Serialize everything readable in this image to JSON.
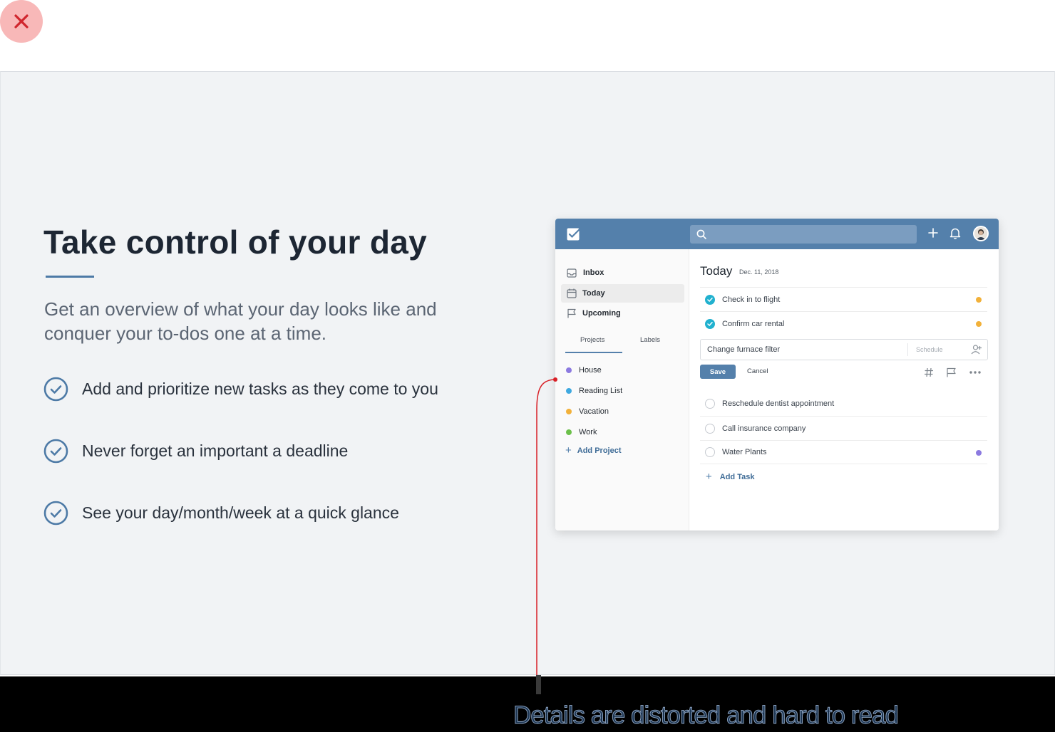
{
  "slide": {
    "headline": "Take control of your day",
    "subhead": "Get an overview of what your day looks like and conquer your to-dos one at a time.",
    "features": [
      {
        "label": "Add and prioritize new tasks as they come to you",
        "icon": "check-circle-icon"
      },
      {
        "label": "Never forget an important a deadline",
        "icon": "check-circle-icon"
      },
      {
        "label": "See your day/month/week at a quick glance",
        "icon": "check-circle-icon"
      }
    ]
  },
  "app": {
    "colors": {
      "header": "#5480ab",
      "done": "#21b1cf"
    },
    "nav": [
      {
        "label": "Inbox",
        "icon": "inbox-icon"
      },
      {
        "label": "Today",
        "icon": "calendar-icon"
      },
      {
        "label": "Upcoming",
        "icon": "flag-icon"
      }
    ],
    "tabs": {
      "projects": "Projects",
      "labels": "Labels"
    },
    "projects": [
      {
        "label": "House",
        "color": "#8c7ae0"
      },
      {
        "label": "Reading List",
        "color": "#3fa9e0"
      },
      {
        "label": "Vacation",
        "color": "#f2b13a"
      },
      {
        "label": "Work",
        "color": "#6cc04a"
      }
    ],
    "add_project": "Add Project",
    "main": {
      "title": "Today",
      "date": "Dec. 11, 2018",
      "done_tasks": [
        {
          "label": "Check in to flight",
          "flag": "#f2b13a"
        },
        {
          "label": "Confirm car rental",
          "flag": "#f2b13a"
        }
      ],
      "edit": {
        "value": "Change furnace filter",
        "schedule_placeholder": "Schedule",
        "save": "Save",
        "cancel": "Cancel"
      },
      "open_tasks": [
        {
          "label": "Reschedule dentist appointment"
        },
        {
          "label": "Call insurance company"
        },
        {
          "label": "Water Plants",
          "flag": "#8c7ae0"
        }
      ],
      "add_task": "Add Task"
    }
  },
  "annotation": {
    "caption": "Details are distorted and hard to read",
    "color": "#d81f26"
  }
}
